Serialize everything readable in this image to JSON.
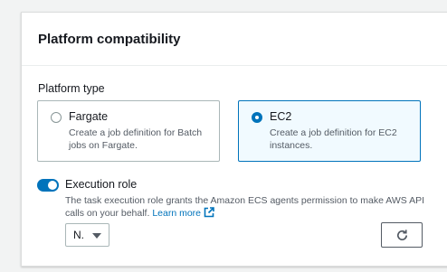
{
  "panel": {
    "title": "Platform compatibility"
  },
  "platform_type": {
    "label": "Platform type",
    "options": [
      {
        "title": "Fargate",
        "description": "Create a job definition for Batch jobs on Fargate.",
        "selected": false
      },
      {
        "title": "EC2",
        "description": "Create a job definition for EC2 instances.",
        "selected": true
      }
    ]
  },
  "execution_role": {
    "label": "Execution role",
    "enabled": true,
    "description": "The task execution role grants the Amazon ECS agents permission to make AWS API calls on your behalf.",
    "learn_more": "Learn more",
    "select_value": "N."
  },
  "icons": {
    "learn_more": "external-link-icon",
    "select": "caret-down-icon",
    "refresh": "refresh-icon"
  },
  "colors": {
    "accent": "#0073bb",
    "selected_tile_bg": "#f1faff",
    "text": "#16191f",
    "secondary_text": "#545b64"
  }
}
